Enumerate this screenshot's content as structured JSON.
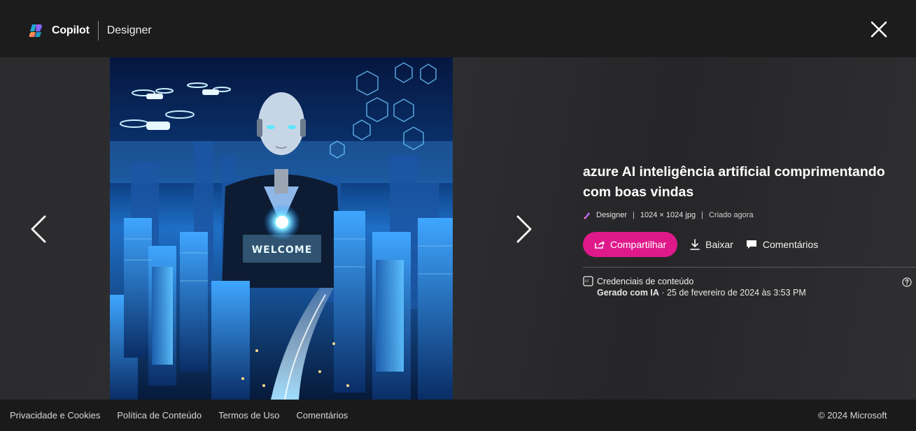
{
  "header": {
    "brand": "Copilot",
    "product": "Designer",
    "close_icon": "close-icon"
  },
  "viewer": {
    "prev_icon": "chevron-left-icon",
    "next_icon": "chevron-right-icon",
    "image": {
      "welcome_text": "WELCOME"
    }
  },
  "details": {
    "prompt": "azure AI inteligência artificial comprimentando com boas vindas",
    "meta": {
      "tool": "Designer",
      "dimensions": "1024 × 1024 jpg",
      "created": "Criado agora"
    },
    "actions": {
      "share": "Compartilhar",
      "download": "Baixar",
      "comments": "Comentários"
    },
    "credentials": {
      "title": "Credenciais de conteúdo",
      "generated_label": "Gerado com IA",
      "date": " · 25 de fevereiro de 2024 às 3:53 PM"
    }
  },
  "footer": {
    "links": [
      "Privacidade e Cookies",
      "Política de Conteúdo",
      "Termos de Uso",
      "Comentários"
    ],
    "copyright": "© 2024 Microsoft"
  },
  "colors": {
    "share_button": "#e0198b",
    "background": "#2a2a2c",
    "footer": "#1a1a1b"
  }
}
